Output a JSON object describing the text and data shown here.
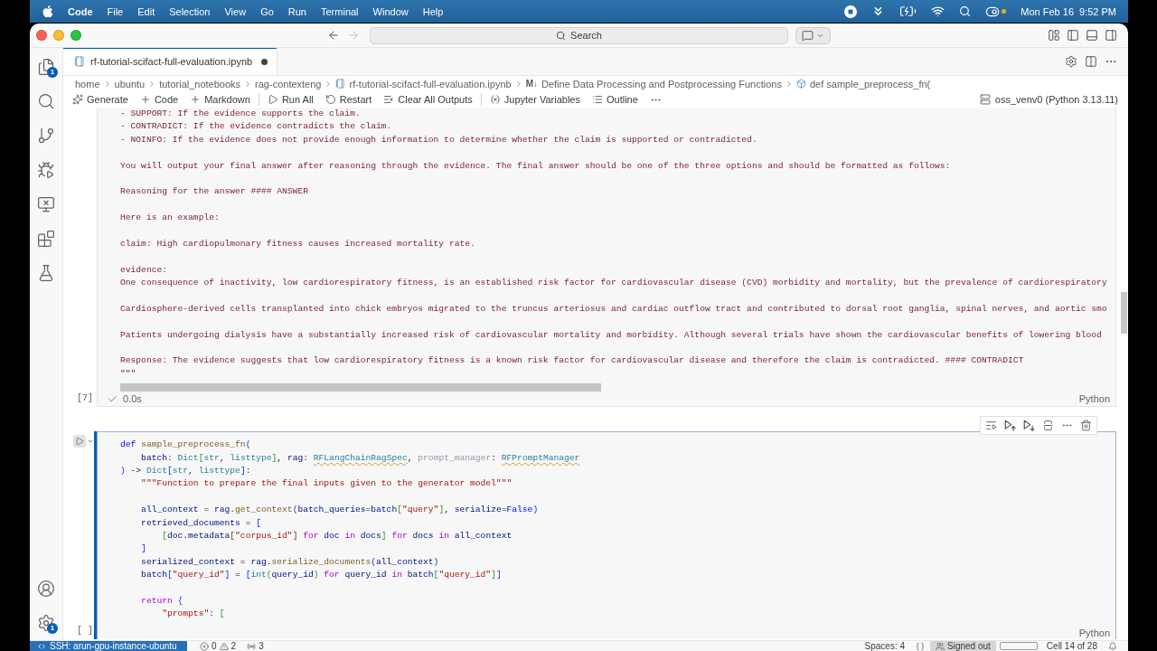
{
  "menu_bar": {
    "app_name": "Code",
    "menus": [
      "File",
      "Edit",
      "Selection",
      "View",
      "Go",
      "Run",
      "Terminal",
      "Window",
      "Help"
    ],
    "extras": [
      {
        "kind": "record"
      },
      {
        "kind": "chevrons"
      },
      {
        "kind": "battery"
      },
      {
        "kind": "wifi"
      },
      {
        "kind": "search"
      },
      {
        "kind": "control_center",
        "indicator": true
      }
    ],
    "date": "Mon Feb 16",
    "time": "9:52 PM"
  },
  "title_bar": {
    "navigation": [
      {
        "kind": "back",
        "disabled": false
      },
      {
        "kind": "forward",
        "disabled": true
      }
    ],
    "command_center": "Search"
  },
  "activity_bar": {
    "top": [
      {
        "kind": "explorer",
        "badge": "1"
      },
      {
        "kind": "search"
      },
      {
        "kind": "source_control"
      },
      {
        "kind": "run_debug"
      },
      {
        "kind": "remote"
      },
      {
        "kind": "extensions"
      },
      {
        "kind": "testing"
      }
    ],
    "bottom": [
      {
        "kind": "accounts"
      },
      {
        "kind": "manage",
        "badge": "1"
      }
    ]
  },
  "tabs": [
    {
      "label": "rf-tutorial-scifact-full-evaluation.ipynb",
      "selected": true,
      "modified": true
    }
  ],
  "breadcrumbs": [
    {
      "kind": "folder",
      "label": "home"
    },
    {
      "kind": "folder",
      "label": "ubuntu"
    },
    {
      "kind": "folder",
      "label": "tutorial_notebooks"
    },
    {
      "kind": "folder",
      "label": "rag-contexteng"
    },
    {
      "kind": "notebook",
      "label": "rf-tutorial-scifact-full-evaluation.ipynb"
    },
    {
      "kind": "markdown",
      "glyph": "M↓",
      "label": "Define Data Processing and Postprocessing Functions"
    },
    {
      "kind": "symbol",
      "label": "def sample_preprocess_fn("
    }
  ],
  "notebook_toolbar": {
    "groups": [
      [
        {
          "kind": "generate",
          "label": "Generate"
        },
        {
          "kind": "add",
          "label": "Code"
        },
        {
          "kind": "add",
          "label": "Markdown"
        }
      ],
      [
        {
          "kind": "run_all",
          "label": "Run All"
        },
        {
          "kind": "restart",
          "label": "Restart"
        },
        {
          "kind": "clear",
          "label": "Clear All Outputs"
        }
      ],
      [
        {
          "kind": "variables",
          "label": "Jupyter Variables"
        },
        {
          "kind": "outline",
          "label": "Outline"
        }
      ]
    ],
    "kernel": "oss_venv0 (Python 3.13.11)"
  },
  "cells": [
    {
      "kind": "output",
      "selected": false,
      "execution_count": "[7]",
      "succeeded": true,
      "duration": "0.0s",
      "language": "Python",
      "paragraphs": [
        [
          "- SUPPORT: If the evidence supports the claim.",
          "- CONTRADICT: If the evidence contradicts the claim.",
          "- NOINFO: If the evidence does not provide enough information to determine whether the claim is supported or contradicted."
        ],
        [
          "You will output your final answer after reasoning through the evidence. The final answer should be one of the three options and should be formatted as follows:"
        ],
        [
          "Reasoning for the answer #### ANSWER"
        ],
        [
          "Here is an example:"
        ],
        [
          "claim: High cardiopulmonary fitness causes increased mortality rate."
        ],
        [
          "evidence:",
          "One consequence of inactivity, low cardiorespiratory fitness, is an established risk factor for cardiovascular disease (CVD) morbidity and mortality, but the prevalence of cardiorespiratory"
        ],
        [
          "Cardiosphere-derived cells transplanted into chick embryos migrated to the truncus arteriosus and cardiac outflow tract and contributed to dorsal root ganglia, spinal nerves, and aortic smo"
        ],
        [
          "Patients undergoing dialysis have a substantially increased risk of cardiovascular mortality and morbidity. Although several trials have shown the cardiovascular benefits of lowering blood"
        ],
        [
          "Response: The evidence suggests that low cardiorespiratory fitness is a known risk factor for cardiovascular disease and therefore the claim is contradicted. #### CONTRADICT",
          "\"\"\""
        ]
      ]
    },
    {
      "kind": "code",
      "selected": true,
      "execution_count": "[ ]",
      "language": "Python",
      "blocks": [
        [
          [
            {
              "kind": "keyword",
              "text": "def"
            },
            {
              "kind": "function",
              "text": " sample_preprocess_fn"
            },
            {
              "kind": "bracket_1",
              "text": "("
            }
          ],
          [
            {
              "kind": "param",
              "text": "    batch"
            },
            {
              "kind": "plain",
              "text": ": "
            },
            {
              "kind": "type",
              "text": "Dict"
            },
            {
              "kind": "bracket_2",
              "text": "["
            },
            {
              "kind": "type",
              "text": "str"
            },
            {
              "kind": "plain",
              "text": ", "
            },
            {
              "kind": "type",
              "text": "listtype"
            },
            {
              "kind": "bracket_2",
              "text": "]"
            },
            {
              "kind": "plain",
              "text": ", "
            },
            {
              "kind": "param",
              "text": "rag"
            },
            {
              "kind": "plain",
              "text": ": "
            },
            {
              "kind": "type_warning",
              "text": "RFLangChainRagSpec"
            },
            {
              "kind": "plain",
              "text": ", "
            },
            {
              "kind": "unused",
              "text": "prompt_manager"
            },
            {
              "kind": "plain",
              "text": ": "
            },
            {
              "kind": "type_warning",
              "text": "RFPromptManager"
            }
          ],
          [
            {
              "kind": "bracket_1",
              "text": ")"
            },
            {
              "kind": "plain",
              "text": " -> "
            },
            {
              "kind": "type",
              "text": "Dict"
            },
            {
              "kind": "bracket_1",
              "text": "["
            },
            {
              "kind": "type",
              "text": "str"
            },
            {
              "kind": "plain",
              "text": ", "
            },
            {
              "kind": "type",
              "text": "listtype"
            },
            {
              "kind": "bracket_1",
              "text": "]"
            },
            {
              "kind": "plain",
              "text": ":"
            }
          ],
          [
            {
              "kind": "string",
              "text": "    \"\"\"Function to prepare the final inputs given to the generator model\"\"\""
            }
          ]
        ],
        [
          [
            {
              "kind": "variable",
              "text": "    all_context"
            },
            {
              "kind": "plain",
              "text": " = "
            },
            {
              "kind": "variable",
              "text": "rag"
            },
            {
              "kind": "plain",
              "text": "."
            },
            {
              "kind": "function",
              "text": "get_context"
            },
            {
              "kind": "bracket_1",
              "text": "("
            },
            {
              "kind": "param",
              "text": "batch_queries"
            },
            {
              "kind": "plain",
              "text": "="
            },
            {
              "kind": "variable",
              "text": "batch"
            },
            {
              "kind": "bracket_2",
              "text": "["
            },
            {
              "kind": "string",
              "text": "\"query\""
            },
            {
              "kind": "bracket_2",
              "text": "]"
            },
            {
              "kind": "plain",
              "text": ", "
            },
            {
              "kind": "param",
              "text": "serialize"
            },
            {
              "kind": "plain",
              "text": "="
            },
            {
              "kind": "constant",
              "text": "False"
            },
            {
              "kind": "bracket_1",
              "text": ")"
            }
          ],
          [
            {
              "kind": "variable",
              "text": "    retrieved_documents"
            },
            {
              "kind": "plain",
              "text": " = "
            },
            {
              "kind": "bracket_1",
              "text": "["
            }
          ],
          [
            {
              "kind": "bracket_2",
              "text": "        ["
            },
            {
              "kind": "variable",
              "text": "doc"
            },
            {
              "kind": "plain",
              "text": "."
            },
            {
              "kind": "variable",
              "text": "metadata"
            },
            {
              "kind": "bracket_3",
              "text": "["
            },
            {
              "kind": "string",
              "text": "\"corpus_id\""
            },
            {
              "kind": "bracket_3",
              "text": "]"
            },
            {
              "kind": "control",
              "text": " for"
            },
            {
              "kind": "variable",
              "text": " doc"
            },
            {
              "kind": "control",
              "text": " in"
            },
            {
              "kind": "variable",
              "text": " docs"
            },
            {
              "kind": "bracket_2",
              "text": "]"
            },
            {
              "kind": "control",
              "text": " for"
            },
            {
              "kind": "variable",
              "text": " docs"
            },
            {
              "kind": "control",
              "text": " in"
            },
            {
              "kind": "variable",
              "text": " all_context"
            }
          ],
          [
            {
              "kind": "bracket_1",
              "text": "    ]"
            }
          ],
          [
            {
              "kind": "variable",
              "text": "    serialized_context"
            },
            {
              "kind": "plain",
              "text": " = "
            },
            {
              "kind": "variable",
              "text": "rag"
            },
            {
              "kind": "plain",
              "text": "."
            },
            {
              "kind": "function",
              "text": "serialize_documents"
            },
            {
              "kind": "bracket_1",
              "text": "("
            },
            {
              "kind": "variable",
              "text": "all_context"
            },
            {
              "kind": "bracket_1",
              "text": ")"
            }
          ],
          [
            {
              "kind": "variable",
              "text": "    batch"
            },
            {
              "kind": "bracket_1",
              "text": "["
            },
            {
              "kind": "string",
              "text": "\"query_id\""
            },
            {
              "kind": "bracket_1",
              "text": "]"
            },
            {
              "kind": "plain",
              "text": " = "
            },
            {
              "kind": "bracket_1",
              "text": "["
            },
            {
              "kind": "type",
              "text": "int"
            },
            {
              "kind": "bracket_2",
              "text": "("
            },
            {
              "kind": "variable",
              "text": "query_id"
            },
            {
              "kind": "bracket_2",
              "text": ")"
            },
            {
              "kind": "control",
              "text": " for"
            },
            {
              "kind": "variable",
              "text": " query_id"
            },
            {
              "kind": "control",
              "text": " in"
            },
            {
              "kind": "variable",
              "text": " batch"
            },
            {
              "kind": "bracket_2",
              "text": "["
            },
            {
              "kind": "string",
              "text": "\"query_id\""
            },
            {
              "kind": "bracket_2",
              "text": "]"
            },
            {
              "kind": "bracket_1",
              "text": "]"
            }
          ]
        ],
        [
          [
            {
              "kind": "control",
              "text": "    return"
            },
            {
              "kind": "bracket_1",
              "text": " {"
            }
          ],
          [
            {
              "kind": "string",
              "text": "        \"prompts\""
            },
            {
              "kind": "plain",
              "text": ": "
            },
            {
              "kind": "bracket_2",
              "text": "["
            }
          ]
        ]
      ]
    }
  ],
  "status_bar": {
    "remote": "SSH: arun-gpu-instance-ubuntu",
    "errors": "0",
    "warnings": "2",
    "ports": "3",
    "indentation": "Spaces: 4",
    "account": "Signed out",
    "cell_position": "Cell 14 of 28"
  }
}
